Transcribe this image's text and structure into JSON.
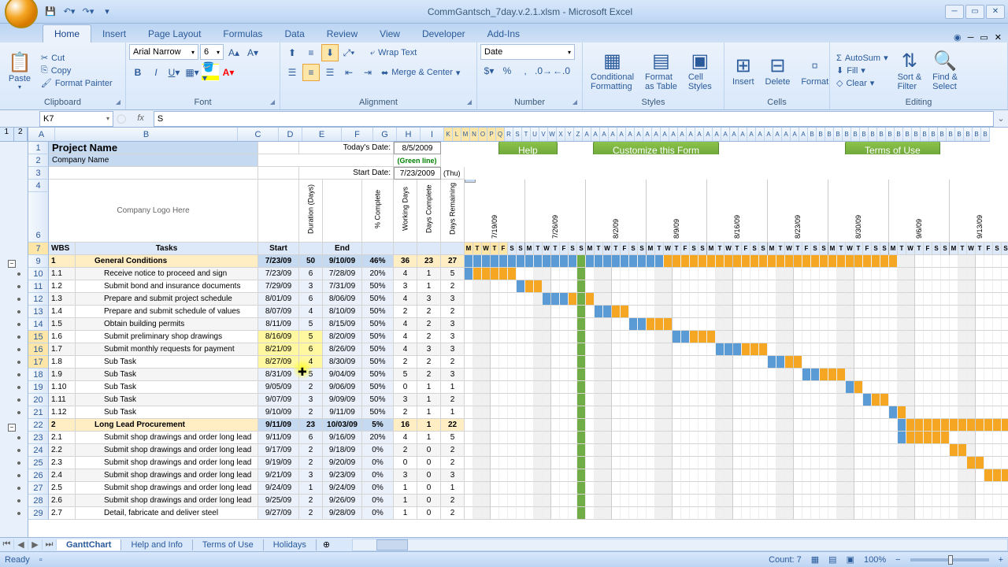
{
  "title": "CommGantsch_7day.v.2.1.xlsm - Microsoft Excel",
  "ribbon_tabs": [
    "Home",
    "Insert",
    "Page Layout",
    "Formulas",
    "Data",
    "Review",
    "View",
    "Developer",
    "Add-Ins"
  ],
  "ribbon": {
    "clipboard": {
      "paste": "Paste",
      "cut": "Cut",
      "copy": "Copy",
      "painter": "Format Painter",
      "label": "Clipboard"
    },
    "font": {
      "name": "Arial Narrow",
      "size": "6",
      "label": "Font"
    },
    "alignment": {
      "wrap": "Wrap Text",
      "merge": "Merge & Center",
      "label": "Alignment"
    },
    "number": {
      "format": "Date",
      "label": "Number"
    },
    "styles": {
      "cond": "Conditional\nFormatting",
      "tbl": "Format\nas Table",
      "cell": "Cell\nStyles",
      "label": "Styles"
    },
    "cells": {
      "insert": "Insert",
      "delete": "Delete",
      "format": "Format",
      "label": "Cells"
    },
    "editing": {
      "sum": "AutoSum",
      "fill": "Fill",
      "clear": "Clear",
      "sort": "Sort &\nFilter",
      "find": "Find &\nSelect",
      "label": "Editing"
    }
  },
  "name_box": "K7",
  "formula": "S",
  "project": {
    "title": "Project Name",
    "company": "Company Name",
    "logo": "Company Logo Here"
  },
  "dates": {
    "today_label": "Today's Date:",
    "today": "8/5/2009",
    "green": "(Green line)",
    "start_label": "Start Date:",
    "start": "7/23/2009",
    "start_day": "(Thu)"
  },
  "buttons": {
    "help": "Help",
    "customize": "Customize this Form",
    "terms": "Terms of Use"
  },
  "col_headers": {
    "wbs": "WBS",
    "tasks": "Tasks",
    "start": "Start",
    "dur": "Duration (Days)",
    "end": "End",
    "pct": "% Complete",
    "wd": "Working Days",
    "dc": "Days Complete",
    "dr": "Days Remaining"
  },
  "date_cols": [
    "7/19/09",
    "7/26/09",
    "8/2/09",
    "8/9/09",
    "8/16/09",
    "8/23/09",
    "8/30/09",
    "9/6/09",
    "9/13/09"
  ],
  "day_letters": [
    "M",
    "T",
    "W",
    "T",
    "F",
    "S",
    "S"
  ],
  "rows": [
    {
      "n": 9,
      "wbs": "1",
      "task": "General Conditions",
      "start": "7/23/09",
      "dur": "50",
      "end": "9/10/09",
      "pct": "46%",
      "wd": "36",
      "dc": "23",
      "dr": "27",
      "grp": true,
      "bar": [
        0,
        50
      ],
      "prog": 23
    },
    {
      "n": 10,
      "wbs": "1.1",
      "task": "Receive notice to proceed and sign contract",
      "start": "7/23/09",
      "dur": "6",
      "end": "7/28/09",
      "pct": "20%",
      "wd": "4",
      "dc": "1",
      "dr": "5",
      "bar": [
        0,
        6
      ],
      "prog": 1
    },
    {
      "n": 11,
      "wbs": "1.2",
      "task": "Submit bond and insurance documents",
      "start": "7/29/09",
      "dur": "3",
      "end": "7/31/09",
      "pct": "50%",
      "wd": "3",
      "dc": "1",
      "dr": "2",
      "bar": [
        6,
        3
      ],
      "prog": 1
    },
    {
      "n": 12,
      "wbs": "1.3",
      "task": "Prepare and submit project schedule",
      "start": "8/01/09",
      "dur": "6",
      "end": "8/06/09",
      "pct": "50%",
      "wd": "4",
      "dc": "3",
      "dr": "3",
      "bar": [
        9,
        6
      ],
      "prog": 3
    },
    {
      "n": 13,
      "wbs": "1.4",
      "task": "Prepare and submit schedule of values",
      "start": "8/07/09",
      "dur": "4",
      "end": "8/10/09",
      "pct": "50%",
      "wd": "2",
      "dc": "2",
      "dr": "2",
      "bar": [
        15,
        4
      ],
      "prog": 2
    },
    {
      "n": 14,
      "wbs": "1.5",
      "task": "Obtain building permits",
      "start": "8/11/09",
      "dur": "5",
      "end": "8/15/09",
      "pct": "50%",
      "wd": "4",
      "dc": "2",
      "dr": "3",
      "bar": [
        19,
        5
      ],
      "prog": 2
    },
    {
      "n": 15,
      "wbs": "1.6",
      "task": "Submit preliminary shop drawings",
      "start": "8/16/09",
      "dur": "5",
      "end": "8/20/09",
      "pct": "50%",
      "wd": "4",
      "dc": "2",
      "dr": "3",
      "bar": [
        24,
        5
      ],
      "prog": 2
    },
    {
      "n": 16,
      "wbs": "1.7",
      "task": "Submit monthly requests for payment",
      "start": "8/21/09",
      "dur": "6",
      "end": "8/26/09",
      "pct": "50%",
      "wd": "4",
      "dc": "3",
      "dr": "3",
      "bar": [
        29,
        6
      ],
      "prog": 3
    },
    {
      "n": 17,
      "wbs": "1.8",
      "task": "Sub Task",
      "start": "8/27/09",
      "dur": "4",
      "end": "8/30/09",
      "pct": "50%",
      "wd": "2",
      "dc": "2",
      "dr": "2",
      "bar": [
        35,
        4
      ],
      "prog": 2
    },
    {
      "n": 18,
      "wbs": "1.9",
      "task": "Sub Task",
      "start": "8/31/09",
      "dur": "5",
      "end": "9/04/09",
      "pct": "50%",
      "wd": "5",
      "dc": "2",
      "dr": "3",
      "bar": [
        39,
        5
      ],
      "prog": 2
    },
    {
      "n": 19,
      "wbs": "1.10",
      "task": "Sub Task",
      "start": "9/05/09",
      "dur": "2",
      "end": "9/06/09",
      "pct": "50%",
      "wd": "0",
      "dc": "1",
      "dr": "1",
      "bar": [
        44,
        2
      ],
      "prog": 1
    },
    {
      "n": 20,
      "wbs": "1.11",
      "task": "Sub Task",
      "start": "9/07/09",
      "dur": "3",
      "end": "9/09/09",
      "pct": "50%",
      "wd": "3",
      "dc": "1",
      "dr": "2",
      "bar": [
        46,
        3
      ],
      "prog": 1
    },
    {
      "n": 21,
      "wbs": "1.12",
      "task": "Sub Task",
      "start": "9/10/09",
      "dur": "2",
      "end": "9/11/09",
      "pct": "50%",
      "wd": "2",
      "dc": "1",
      "dr": "1",
      "bar": [
        49,
        2
      ],
      "prog": 1
    },
    {
      "n": 22,
      "wbs": "2",
      "task": "Long Lead Procurement",
      "start": "9/11/09",
      "dur": "23",
      "end": "10/03/09",
      "pct": "5%",
      "wd": "16",
      "dc": "1",
      "dr": "22",
      "grp": true,
      "bar": [
        50,
        23
      ],
      "prog": 1
    },
    {
      "n": 23,
      "wbs": "2.1",
      "task": "Submit shop drawings and order long lead items -",
      "start": "9/11/09",
      "dur": "6",
      "end": "9/16/09",
      "pct": "20%",
      "wd": "4",
      "dc": "1",
      "dr": "5",
      "bar": [
        50,
        6
      ],
      "prog": 1
    },
    {
      "n": 24,
      "wbs": "2.2",
      "task": "Submit shop drawings and order long lead items -",
      "start": "9/17/09",
      "dur": "2",
      "end": "9/18/09",
      "pct": "0%",
      "wd": "2",
      "dc": "0",
      "dr": "2",
      "bar": [
        56,
        2
      ],
      "prog": 0
    },
    {
      "n": 25,
      "wbs": "2.3",
      "task": "Submit shop drawings and order long lead items -",
      "start": "9/19/09",
      "dur": "2",
      "end": "9/20/09",
      "pct": "0%",
      "wd": "0",
      "dc": "0",
      "dr": "2",
      "bar": [
        58,
        2
      ],
      "prog": 0
    },
    {
      "n": 26,
      "wbs": "2.4",
      "task": "Submit shop drawings and order long lead items -",
      "start": "9/21/09",
      "dur": "3",
      "end": "9/23/09",
      "pct": "0%",
      "wd": "3",
      "dc": "0",
      "dr": "3",
      "bar": [
        60,
        3
      ],
      "prog": 0
    },
    {
      "n": 27,
      "wbs": "2.5",
      "task": "Submit shop drawings and order long lead items -",
      "start": "9/24/09",
      "dur": "1",
      "end": "9/24/09",
      "pct": "0%",
      "wd": "1",
      "dc": "0",
      "dr": "1",
      "bar": [
        63,
        1
      ],
      "prog": 0
    },
    {
      "n": 28,
      "wbs": "2.6",
      "task": "Submit shop drawings and order long lead items -",
      "start": "9/25/09",
      "dur": "2",
      "end": "9/26/09",
      "pct": "0%",
      "wd": "1",
      "dc": "0",
      "dr": "2",
      "bar": [
        64,
        2
      ],
      "prog": 0
    },
    {
      "n": 29,
      "wbs": "2.7",
      "task": "Detail, fabricate and deliver steel",
      "start": "9/27/09",
      "dur": "2",
      "end": "9/28/09",
      "pct": "0%",
      "wd": "1",
      "dc": "0",
      "dr": "2",
      "bar": [
        66,
        2
      ],
      "prog": 0
    }
  ],
  "sheets": [
    "GanttChart",
    "Help and Info",
    "Terms of Use",
    "Holidays"
  ],
  "status": {
    "ready": "Ready",
    "count": "Count: 7",
    "zoom": "100%"
  }
}
